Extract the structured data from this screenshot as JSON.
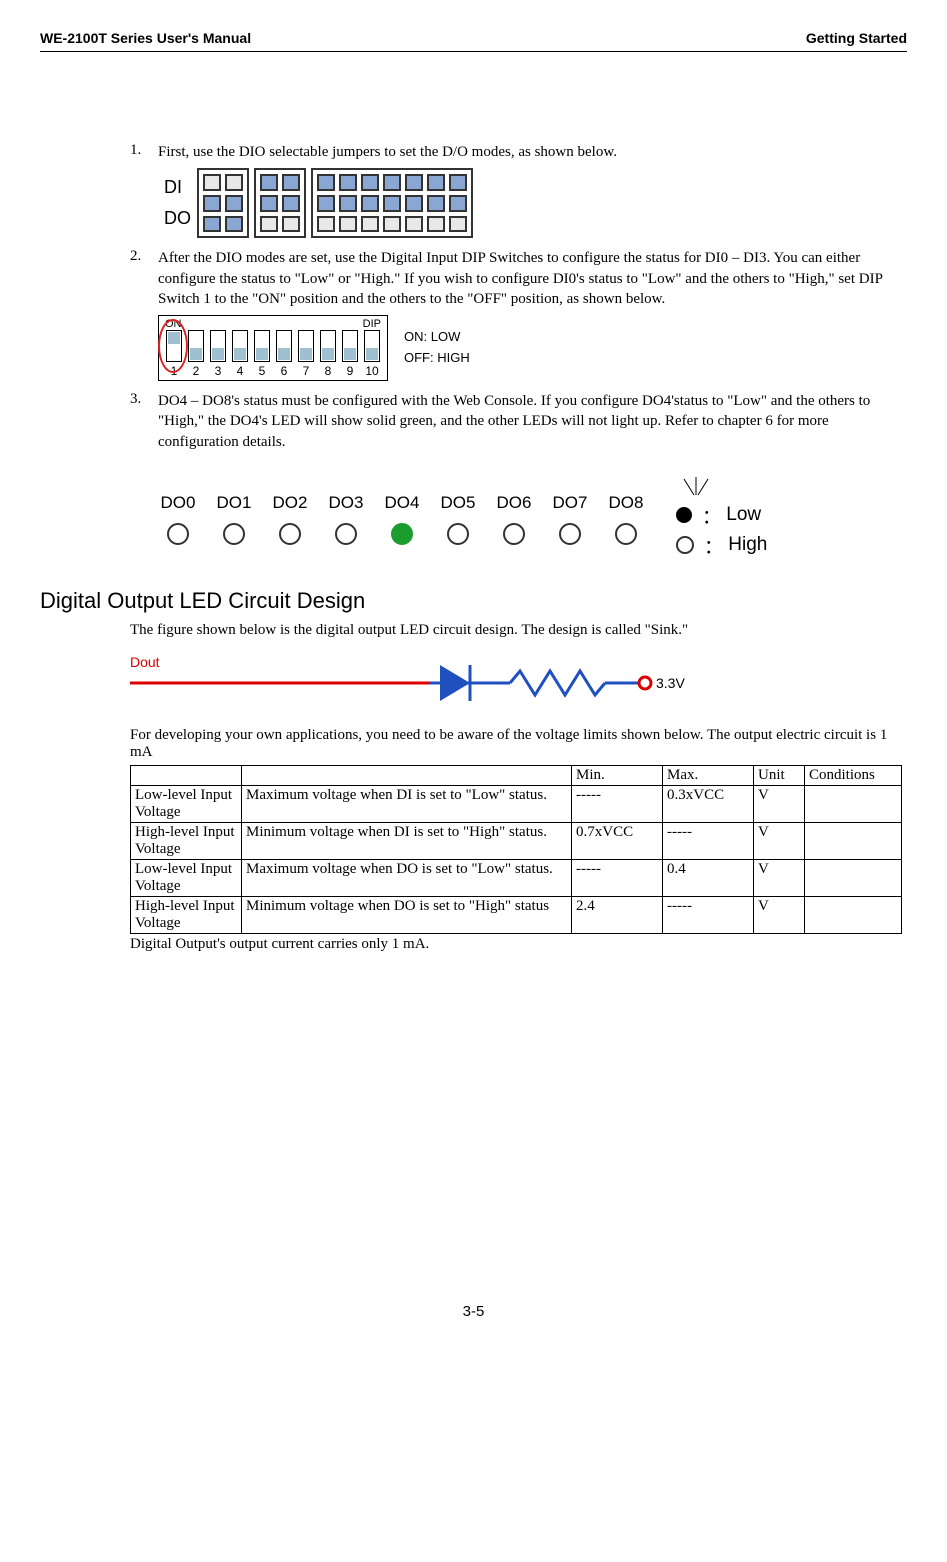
{
  "header": {
    "left": "WE-2100T Series User's Manual",
    "right": "Getting Started"
  },
  "items": {
    "n1": "1.",
    "t1": "First, use the DIO selectable jumpers to set the D/O modes, as shown below.",
    "n2": "2.",
    "t2": "After the DIO modes are set, use the Digital Input DIP Switches to configure the status for DI0 – DI3. You can either configure the status to \"Low\" or \"High.\" If you wish to configure DI0's status to \"Low\" and the others to \"High,\" set DIP Switch 1 to the \"ON\" position and the others to the \"OFF\" position, as shown below.",
    "n3": "3.",
    "t3": "DO4 – DO8's status must be configured with the Web Console. If you configure DO4'status to \"Low\" and the others to \"High,\" the DO4's LED will show solid green, and the other LEDs will not light up. Refer to chapter 6 for more configuration details."
  },
  "dido": {
    "di": "DI",
    "do": "DO"
  },
  "dip": {
    "on": "ON",
    "dip": "DIP",
    "nums": [
      "1",
      "2",
      "3",
      "4",
      "5",
      "6",
      "7",
      "8",
      "9",
      "10"
    ],
    "legend_on": "ON: LOW",
    "legend_off": "OFF: HIGH"
  },
  "doled": {
    "labels": [
      "DO0",
      "DO1",
      "DO2",
      "DO3",
      "DO4",
      "DO5",
      "DO6",
      "DO7",
      "DO8"
    ],
    "legend_low": "Low",
    "legend_high": "High",
    "sep": "："
  },
  "h2": "Digital Output LED Circuit Design",
  "para1": "The figure shown below is the digital output LED circuit design. The design is called \"Sink.\"",
  "circuit": {
    "dout": "Dout",
    "v33": "3.3V"
  },
  "para2": "For developing your own applications, you need to be aware of the voltage limits shown below. The output electric circuit is 1 mA",
  "table": {
    "head": [
      "",
      "",
      "Min.",
      "Max.",
      "Unit",
      "Conditions"
    ],
    "rows": [
      [
        "Low-level Input Voltage",
        "Maximum voltage when DI is set to \"Low\" status.",
        "-----",
        "0.3xVCC",
        "V",
        ""
      ],
      [
        "High-level Input Voltage",
        "Minimum voltage when DI is set to \"High\" status.",
        "0.7xVCC",
        "-----",
        "V",
        ""
      ],
      [
        "Low-level Input Voltage",
        "Maximum voltage when DO is set to \"Low\" status.",
        "-----",
        "0.4",
        "V",
        ""
      ],
      [
        "High-level Input Voltage",
        "Minimum voltage when DO is set to \"High\" status",
        "2.4",
        "-----",
        "V",
        ""
      ]
    ]
  },
  "after_table": "Digital Output's output current carries only 1 mA.",
  "footer": "3-5"
}
